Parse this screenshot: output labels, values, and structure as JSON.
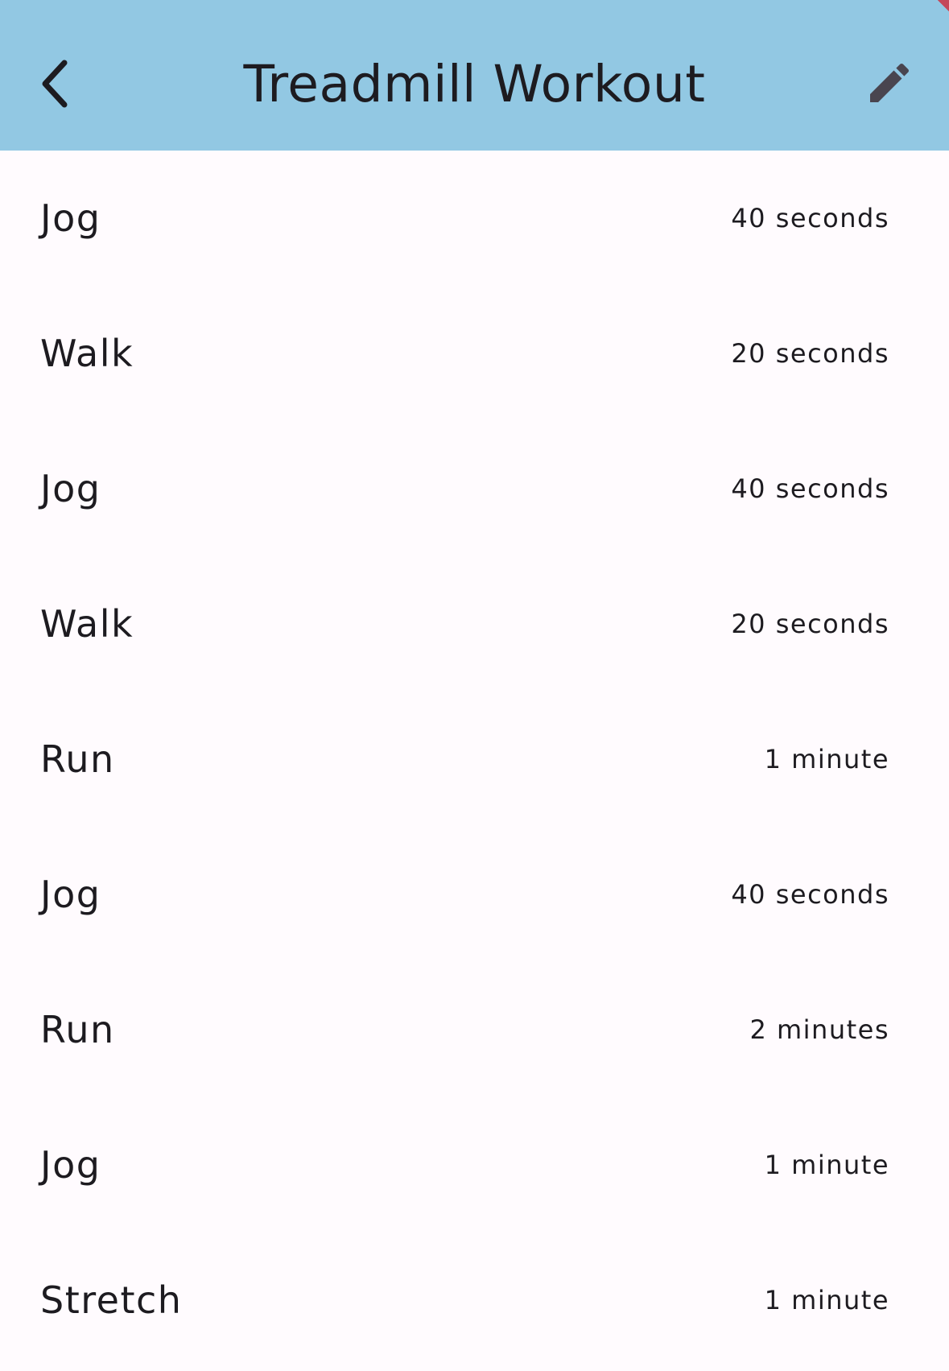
{
  "app_bar": {
    "title": "Treadmill Workout",
    "background_color": "#92c8e3",
    "back_icon": "chevron-left-icon",
    "edit_icon": "pencil-icon"
  },
  "workout_steps": [
    {
      "label": "Jog",
      "duration": "40 seconds"
    },
    {
      "label": "Walk",
      "duration": "20 seconds"
    },
    {
      "label": "Jog",
      "duration": "40 seconds"
    },
    {
      "label": "Walk",
      "duration": "20 seconds"
    },
    {
      "label": "Run",
      "duration": "1 minute"
    },
    {
      "label": "Jog",
      "duration": "40 seconds"
    },
    {
      "label": "Run",
      "duration": "2 minutes"
    },
    {
      "label": "Jog",
      "duration": "1 minute"
    },
    {
      "label": "Stretch",
      "duration": "1 minute"
    }
  ]
}
